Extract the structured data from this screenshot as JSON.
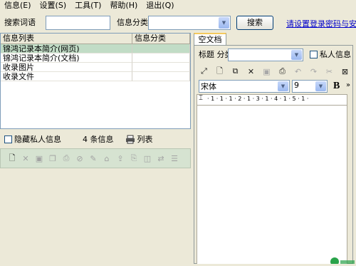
{
  "menu": [
    {
      "label": "信息(E)",
      "name": "menu-info"
    },
    {
      "label": "设置(S)",
      "name": "menu-settings"
    },
    {
      "label": "工具(T)",
      "name": "menu-tools"
    },
    {
      "label": "帮助(H)",
      "name": "menu-help"
    },
    {
      "label": "退出(Q)",
      "name": "menu-exit"
    }
  ],
  "search": {
    "keyword_label": "搜索词语",
    "keyword_value": "",
    "category_label": "信息分类",
    "category_value": "",
    "button": "搜索",
    "link": "请设置登录密码与安全"
  },
  "list": {
    "columns": [
      "信息列表",
      "信息分类"
    ],
    "rows": [
      {
        "title": "锦鸿记录本简介(网页)",
        "category": ""
      },
      {
        "title": "锦鸿记录本简介(文档)",
        "category": ""
      },
      {
        "title": "收录图片",
        "category": ""
      },
      {
        "title": "收录文件",
        "category": ""
      }
    ],
    "selected_row": 0
  },
  "status": {
    "hide_private_label": "隐藏私人信息",
    "count_text": "4 条信息",
    "view_label": "列表"
  },
  "document": {
    "tab_label": "空文档",
    "category_label": "标题 分类",
    "category_value": "",
    "private_label": "私人信息",
    "font_name": "宋体",
    "font_size": "9",
    "bold_label": "B",
    "ruler_text": "· 1 · 1 · 1 · 2 · 1 · 3 · 1 · 4 · 1 · 5 · 1 ·"
  },
  "colors": {
    "window_bg": "#ece9d8",
    "selected_row": "#c1dcc6",
    "toolbar_bg": "#d6e3d1",
    "link": "#0000cc",
    "tab_accent": "#f4c95d",
    "watermark": "#2aa34a"
  }
}
